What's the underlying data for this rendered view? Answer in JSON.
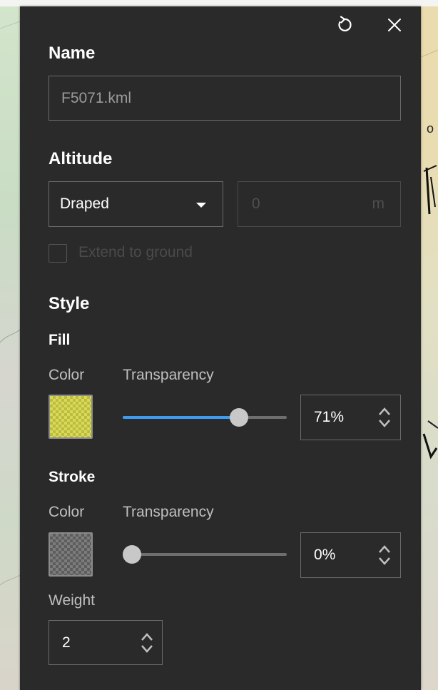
{
  "header": {
    "reset_icon": "reset-icon",
    "close_icon": "close-icon"
  },
  "name": {
    "label": "Name",
    "value": "F5071.kml"
  },
  "altitude": {
    "label": "Altitude",
    "mode_selected": "Draped",
    "offset_placeholder": "0",
    "unit": "m",
    "extend_label": "Extend to ground",
    "extend_checked": false
  },
  "style": {
    "label": "Style",
    "fill": {
      "label": "Fill",
      "color_label": "Color",
      "transparency_label": "Transparency",
      "color": "#d8d859",
      "transparency_percent": 71,
      "transparency_text": "71%"
    },
    "stroke": {
      "label": "Stroke",
      "color_label": "Color",
      "transparency_label": "Transparency",
      "color": "#7c7c7c",
      "transparency_percent": 0,
      "transparency_text": "0%",
      "weight_label": "Weight",
      "weight_value": "2"
    }
  },
  "map_text": {
    "right_edge_letter": "o"
  },
  "colors": {
    "panel_bg": "#2a2a2a",
    "accent": "#3d9bf0",
    "border": "#6b6b6b"
  }
}
